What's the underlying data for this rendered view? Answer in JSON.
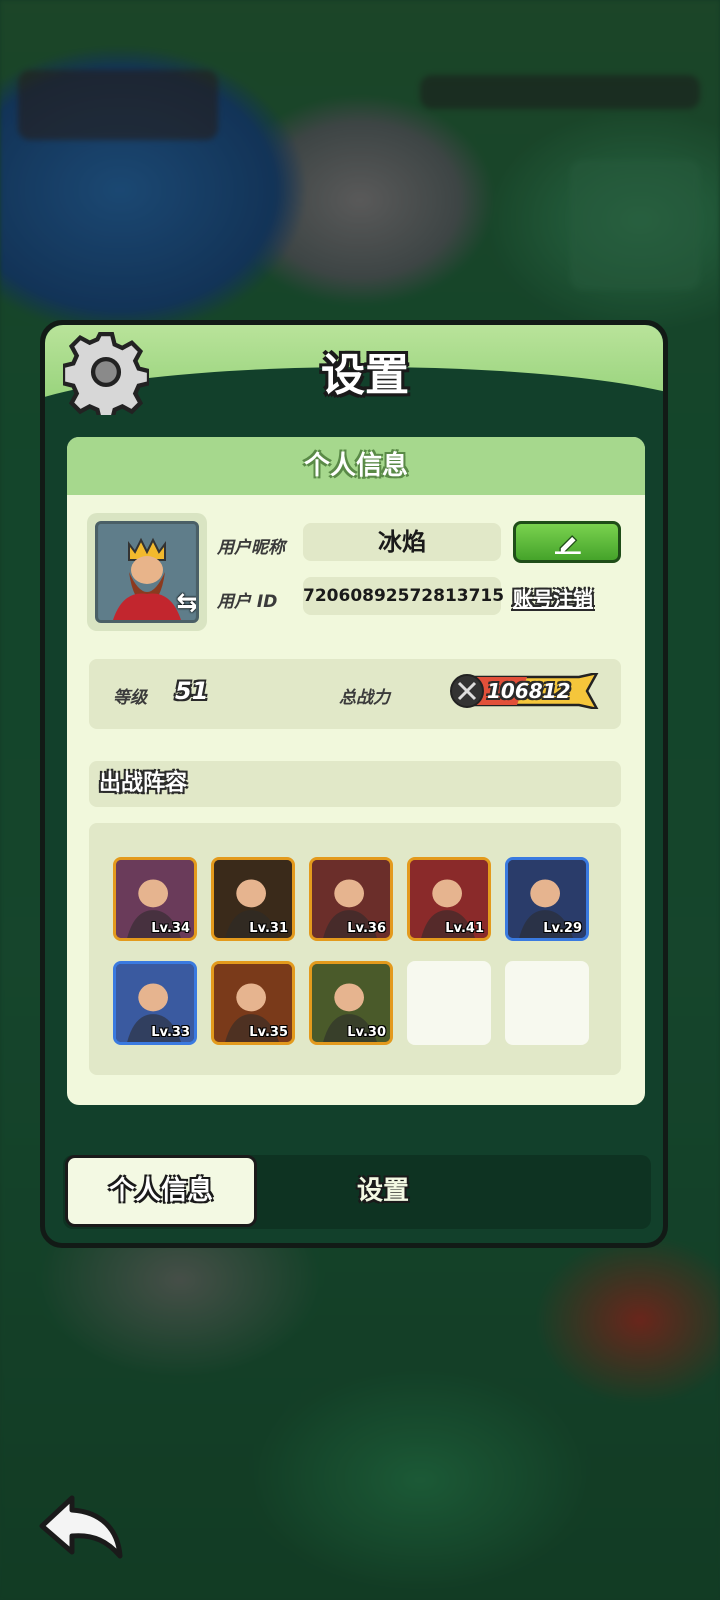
{
  "header": {
    "title": "设置"
  },
  "card": {
    "heading": "个人信息",
    "nickname_label": "用户昵称",
    "nickname_value": "冰焰",
    "id_label": "用户 ID",
    "id_value": "72060892572813715",
    "logout_label": "账号注销",
    "level_label": "等级",
    "level_value": "51",
    "power_label": "总战力",
    "power_value": "106812",
    "lineup_heading": "出战阵容"
  },
  "lineup": [
    {
      "level": "Lv.34",
      "frame": "gold"
    },
    {
      "level": "Lv.31",
      "frame": "gold"
    },
    {
      "level": "Lv.36",
      "frame": "gold"
    },
    {
      "level": "Lv.41",
      "frame": "gold"
    },
    {
      "level": "Lv.29",
      "frame": "blue"
    },
    {
      "level": "Lv.33",
      "frame": "blue"
    },
    {
      "level": "Lv.35",
      "frame": "gold"
    },
    {
      "level": "Lv.30",
      "frame": "gold"
    },
    {
      "level": "",
      "frame": "empty"
    },
    {
      "level": "",
      "frame": "empty"
    }
  ],
  "tabs": {
    "active": "个人信息",
    "other": "设置"
  },
  "colors": {
    "panel_green": "#a6d88d",
    "card_bg": "#f1f8dc",
    "edit_green": "#45a32a"
  }
}
